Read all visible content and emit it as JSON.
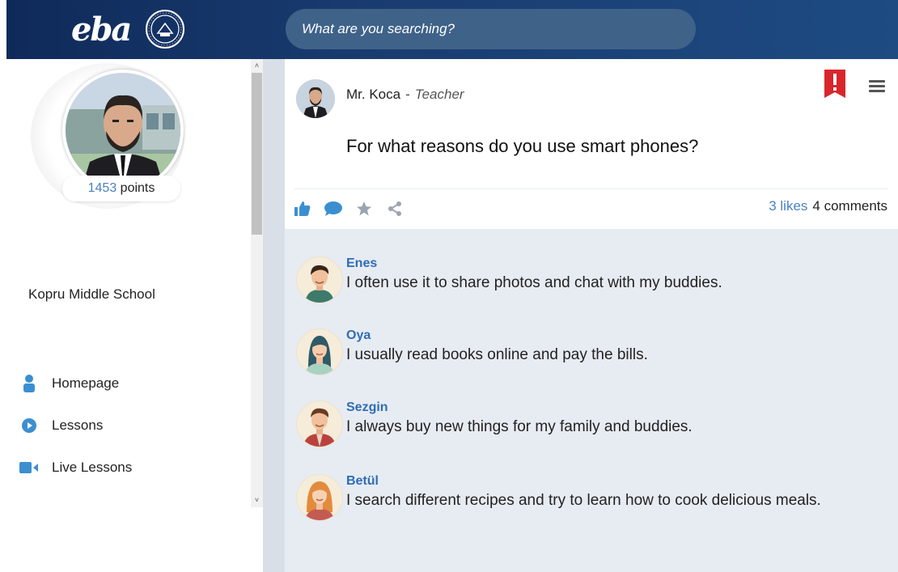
{
  "header": {
    "logo_text": "eba",
    "search_placeholder": "What are you searching?",
    "brand_color": "#1a3d72"
  },
  "sidebar": {
    "points_value": "1453",
    "points_label": " points",
    "school": "Kopru Middle School",
    "nav": [
      {
        "label": "Homepage",
        "icon": "person-icon"
      },
      {
        "label": "Lessons",
        "icon": "play-circle-icon"
      },
      {
        "label": "Live Lessons",
        "icon": "video-camera-icon"
      }
    ]
  },
  "post": {
    "author": "Mr. Koca",
    "separator": "-",
    "role": "Teacher",
    "question": "For what reasons do you use smart phones?",
    "likes": "3 likes",
    "comments_count": "4 comments",
    "actions": [
      "like-icon",
      "comment-icon",
      "star-icon",
      "share-icon"
    ]
  },
  "comments": [
    {
      "name": "Enes",
      "text": "I often use it to share photos and chat with my buddies."
    },
    {
      "name": "Oya",
      "text": "I usually read books online and pay the bills."
    },
    {
      "name": "Sezgin",
      "text": "I always buy new things for my family and buddies."
    },
    {
      "name": "Betül",
      "text": "I search different recipes and try to learn how to cook delicious meals."
    }
  ],
  "colors": {
    "accent": "#4a82c3",
    "name": "#2e6db4",
    "flag": "#d9262c",
    "icon": "#3b8fd1"
  }
}
